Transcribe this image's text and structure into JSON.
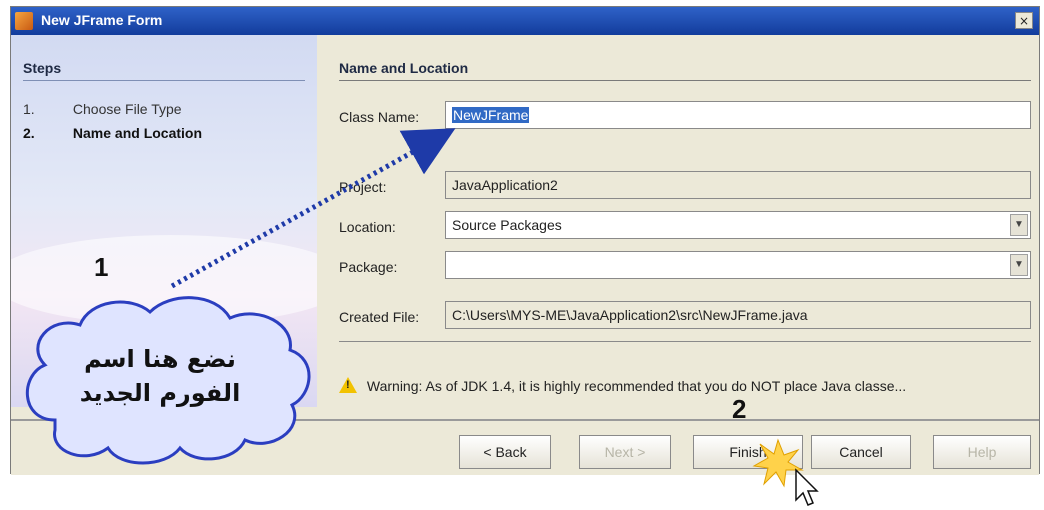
{
  "window": {
    "title": "New JFrame Form",
    "close_glyph": "×"
  },
  "steps": {
    "title": "Steps",
    "items": [
      {
        "num": "1.",
        "label": "Choose File Type"
      },
      {
        "num": "2.",
        "label": "Name and Location"
      }
    ]
  },
  "form": {
    "section_title": "Name and Location",
    "class_name": {
      "label": "Class Name:",
      "value": "NewJFrame"
    },
    "project": {
      "label": "Project:",
      "value": "JavaApplication2"
    },
    "location": {
      "label": "Location:",
      "value": "Source Packages"
    },
    "package": {
      "label": "Package:",
      "value": ""
    },
    "created_file": {
      "label": "Created File:",
      "value": "C:\\Users\\MYS-ME\\JavaApplication2\\src\\NewJFrame.java"
    },
    "warning": "Warning: As of JDK 1.4, it is highly recommended that you do NOT place Java classe..."
  },
  "buttons": {
    "back": "< Back",
    "next": "Next >",
    "finish": "Finish",
    "cancel": "Cancel",
    "help": "Help"
  },
  "annotations": {
    "step1_number": "1",
    "step2_number": "2",
    "cloud_line1": "نضع هنا اسم",
    "cloud_line2": "الفورم الجديد"
  },
  "colors": {
    "titlebar": "#1e4fb5",
    "selection": "#316ac5",
    "arrow": "#1e3aa8",
    "cloud_fill": "#dfe4ff",
    "cloud_stroke": "#2b3ec0",
    "burst": "#ffd24a"
  }
}
